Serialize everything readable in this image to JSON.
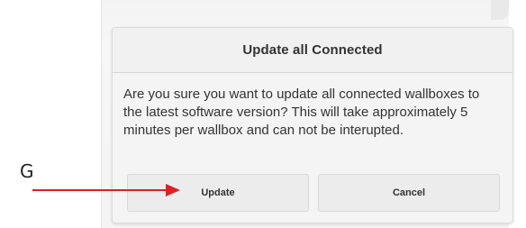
{
  "dialog": {
    "title": "Update all Connected",
    "message": "Are you sure you want to update all connected wallboxes to the latest software version? This will take approximately 5 minutes per wallbox and can not be interupted.",
    "update_label": "Update",
    "cancel_label": "Cancel"
  },
  "annotation": {
    "letter": "G",
    "arrow_color": "#e02020",
    "arrow_icon": "arrow-right-icon"
  }
}
